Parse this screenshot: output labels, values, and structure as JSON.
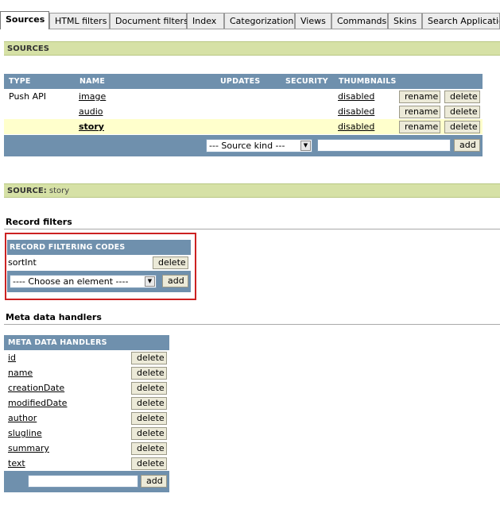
{
  "tabs": [
    {
      "label": "Sources",
      "active": true
    },
    {
      "label": "HTML filters"
    },
    {
      "label": "Document filters"
    },
    {
      "label": "Index"
    },
    {
      "label": "Categorization"
    },
    {
      "label": "Views"
    },
    {
      "label": "Commands"
    },
    {
      "label": "Skins"
    },
    {
      "label": "Search Applications"
    }
  ],
  "sources_bar": "SOURCES",
  "sources_table": {
    "headers": {
      "type": "TYPE",
      "name": "NAME",
      "updates": "UPDATES",
      "security": "SECURITY",
      "thumbnails": "THUMBNAILS"
    },
    "rows": [
      {
        "type": "Push API",
        "name": "image",
        "thumbnails": "disabled",
        "rename": "rename",
        "delete": "delete"
      },
      {
        "type": "",
        "name": "audio",
        "thumbnails": "disabled",
        "rename": "rename",
        "delete": "delete"
      },
      {
        "type": "",
        "name": "story",
        "thumbnails": "disabled",
        "rename": "rename",
        "delete": "delete",
        "selected": true
      }
    ],
    "source_kind_select": "--- Source kind ---",
    "name_input_value": "",
    "add_label": "add"
  },
  "source_bar": {
    "label": "SOURCE:",
    "value": "story"
  },
  "record_filters": {
    "heading": "Record filters",
    "table_header": "RECORD FILTERING CODES",
    "rows": [
      {
        "name": "sortInt",
        "delete": "delete"
      }
    ],
    "choose_select": "---- Choose an element ----",
    "add_label": "add"
  },
  "meta_handlers": {
    "heading": "Meta data handlers",
    "table_header": "META DATA HANDLERS",
    "rows": [
      {
        "name": "id",
        "delete": "delete"
      },
      {
        "name": "name",
        "delete": "delete"
      },
      {
        "name": "creationDate",
        "delete": "delete"
      },
      {
        "name": "modifiedDate",
        "delete": "delete"
      },
      {
        "name": "author",
        "delete": "delete"
      },
      {
        "name": "slugline",
        "delete": "delete"
      },
      {
        "name": "summary",
        "delete": "delete"
      },
      {
        "name": "text",
        "delete": "delete"
      }
    ],
    "input_value": "",
    "add_label": "add"
  },
  "colors": {
    "header_blue": "#6f90ad",
    "section_green": "#d6e1a6",
    "selected_row": "#ffffcc",
    "highlight_red": "#cc2222"
  }
}
